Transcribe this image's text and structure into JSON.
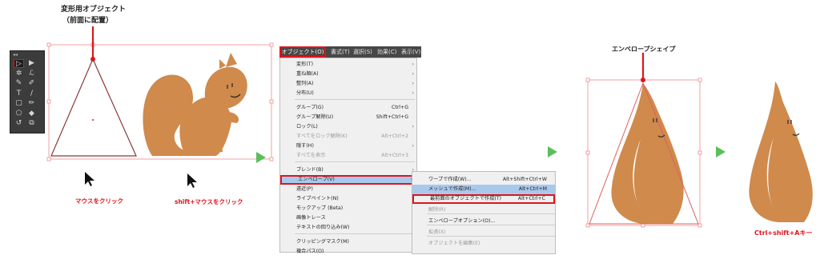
{
  "colors": {
    "accent_red": "#e0141c",
    "squirrel": "#cf8a4c",
    "play_green": "#5bbf5b",
    "menu_highlight": "#a9c9ec"
  },
  "step1": {
    "title_line1": "変形用オブジェクト",
    "title_line2": "（前面に配置）",
    "caption_left": "マウスをクリック",
    "caption_right": "shift+マウスをクリック",
    "cursor_icon": "arrow-cursor-icon"
  },
  "toolbar": {
    "tools": [
      "selection-tool-icon",
      "direct-selection-tool-icon",
      "magic-wand-tool-icon",
      "lasso-tool-icon",
      "pen-tool-icon",
      "curvature-tool-icon",
      "type-tool-icon",
      "line-tool-icon",
      "rectangle-tool-icon",
      "paintbrush-tool-icon",
      "shaper-tool-icon",
      "eraser-tool-icon",
      "rotate-tool-icon",
      "scale-tool-icon"
    ]
  },
  "menubar": {
    "items": [
      "オブジェクト(O)",
      "書式(T)",
      "選択(S)",
      "効果(C)",
      "表示(V)"
    ]
  },
  "object_menu": {
    "items": [
      {
        "label": "変形(T)",
        "shortcut": "",
        "arrow": true,
        "disabled": false
      },
      {
        "label": "重ね順(A)",
        "shortcut": "",
        "arrow": true,
        "disabled": false
      },
      {
        "label": "整列(A)",
        "shortcut": "",
        "arrow": true,
        "disabled": false
      },
      {
        "label": "分布(U)",
        "shortcut": "",
        "arrow": true,
        "disabled": false
      },
      {
        "label": "グループ(G)",
        "shortcut": "Ctrl+G",
        "arrow": false,
        "disabled": false
      },
      {
        "label": "グループ解除(U)",
        "shortcut": "Shift+Ctrl+G",
        "arrow": false,
        "disabled": false
      },
      {
        "label": "ロック(L)",
        "shortcut": "",
        "arrow": true,
        "disabled": false
      },
      {
        "label": "すべてをロック解除(K)",
        "shortcut": "Alt+Ctrl+2",
        "arrow": false,
        "disabled": true
      },
      {
        "label": "隠す(H)",
        "shortcut": "",
        "arrow": true,
        "disabled": false
      },
      {
        "label": "すべてを表示",
        "shortcut": "Alt+Ctrl+3",
        "arrow": false,
        "disabled": true
      },
      {
        "label": "ブレンド(B)",
        "shortcut": "",
        "arrow": true,
        "disabled": false
      },
      {
        "label": "エンベロープ(V)",
        "shortcut": "",
        "arrow": true,
        "disabled": false
      },
      {
        "label": "遠近(P)",
        "shortcut": "",
        "arrow": true,
        "disabled": false
      },
      {
        "label": "ライブペイント(N)",
        "shortcut": "",
        "arrow": true,
        "disabled": false
      },
      {
        "label": "モックアップ (Beta)",
        "shortcut": "",
        "arrow": true,
        "disabled": false
      },
      {
        "label": "画像トレース",
        "shortcut": "",
        "arrow": true,
        "disabled": false
      },
      {
        "label": "テキストの回り込み(W)",
        "shortcut": "",
        "arrow": true,
        "disabled": false
      },
      {
        "label": "クリッピングマスク(M)",
        "shortcut": "",
        "arrow": true,
        "disabled": false
      },
      {
        "label": "複合パス(O)",
        "shortcut": "",
        "arrow": true,
        "disabled": false
      }
    ]
  },
  "envelope_submenu": {
    "items": [
      {
        "label": "ワープで作成(W)...",
        "shortcut": "Alt+Shift+Ctrl+W",
        "disabled": false
      },
      {
        "label": "メッシュで作成(M)...",
        "shortcut": "Alt+Ctrl+M",
        "disabled": false
      },
      {
        "label": "最前面のオブジェクトで作成(T)",
        "shortcut": "Alt+Ctrl+C",
        "disabled": false
      },
      {
        "label": "解除(R)",
        "shortcut": "",
        "disabled": true
      },
      {
        "label": "エンベロープオプション(O)...",
        "shortcut": "",
        "disabled": false
      },
      {
        "label": "拡張(X)",
        "shortcut": "",
        "disabled": true
      },
      {
        "label": "オブジェクトを編集(E)",
        "shortcut": "",
        "disabled": true
      }
    ]
  },
  "step3": {
    "title": "エンベロープシェイプ"
  },
  "step4": {
    "caption": "Ctrl+shift+Aキー"
  }
}
